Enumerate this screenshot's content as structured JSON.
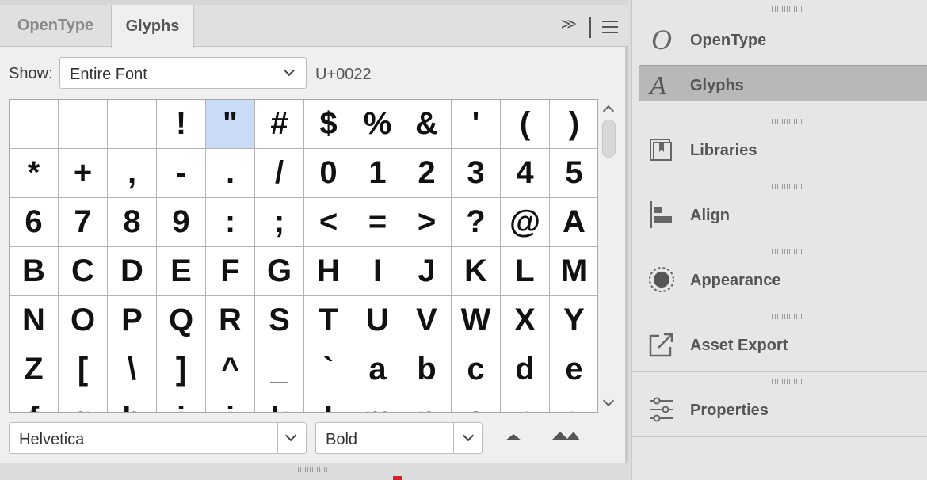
{
  "tabs": [
    "OpenType",
    "Glyphs"
  ],
  "collapse_label": ">>",
  "show": {
    "label": "Show:",
    "value": "Entire Font",
    "unicode": "U+0022"
  },
  "glyphs": [
    "",
    "",
    "",
    "!",
    "\"",
    "#",
    "$",
    "%",
    "&",
    "'",
    "(",
    ")",
    "*",
    "+",
    ",",
    "-",
    ".",
    "/",
    "0",
    "1",
    "2",
    "3",
    "4",
    "5",
    "6",
    "7",
    "8",
    "9",
    ":",
    ";",
    "<",
    "=",
    ">",
    "?",
    "@",
    "A",
    "B",
    "C",
    "D",
    "E",
    "F",
    "G",
    "H",
    "I",
    "J",
    "K",
    "L",
    "M",
    "N",
    "O",
    "P",
    "Q",
    "R",
    "S",
    "T",
    "U",
    "V",
    "W",
    "X",
    "Y",
    "Z",
    "[",
    "\\",
    "]",
    "^",
    "_",
    "`",
    "a",
    "b",
    "c",
    "d",
    "e",
    "f",
    "g",
    "h",
    "i",
    "j",
    "k",
    "l",
    "m",
    "n",
    "o",
    "p",
    "q"
  ],
  "selected_glyph": "\"",
  "font": {
    "family": "Helvetica",
    "style": "Bold"
  },
  "right_panel": {
    "items": [
      {
        "label": "OpenType",
        "icon": "opentype-icon",
        "selected": false
      },
      {
        "label": "Glyphs",
        "icon": "glyphs-icon",
        "selected": true
      },
      {
        "label": "Libraries",
        "icon": "libraries-icon",
        "selected": false
      },
      {
        "label": "Align",
        "icon": "align-icon",
        "selected": false
      },
      {
        "label": "Appearance",
        "icon": "appearance-icon",
        "selected": false
      },
      {
        "label": "Asset Export",
        "icon": "asset-export-icon",
        "selected": false
      },
      {
        "label": "Properties",
        "icon": "properties-icon",
        "selected": false
      }
    ]
  },
  "colors": {
    "selection": "#c9dbf6",
    "accent_red": "#d6202a"
  }
}
